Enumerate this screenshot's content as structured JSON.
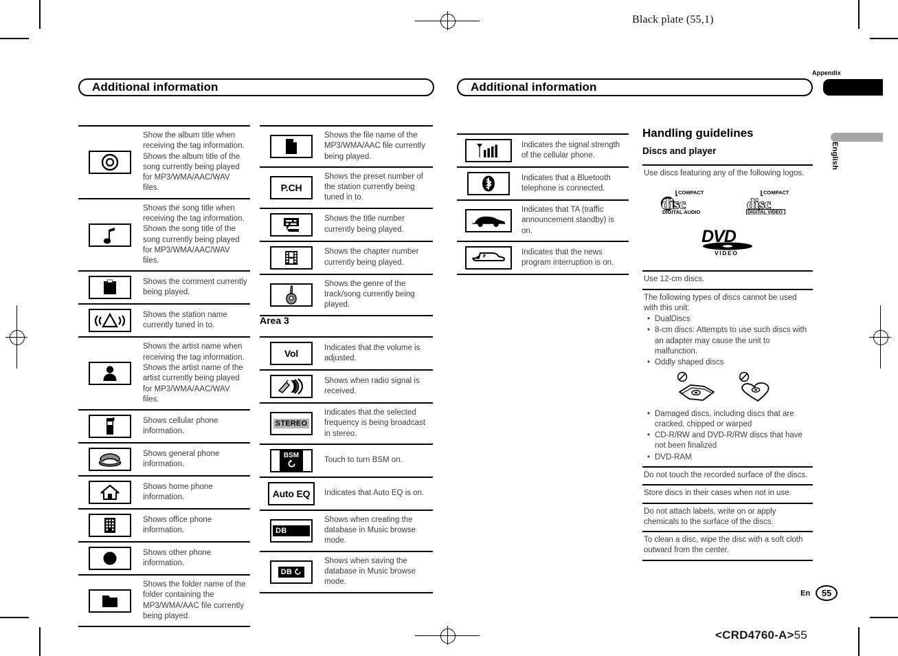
{
  "page": {
    "plate_label": "Black plate (55,1)",
    "footer_code_prefix": "<CRD4760-A>",
    "footer_code_suffix": "55",
    "page_number": "55",
    "page_lang": "En",
    "tab_appendix": "Appendix",
    "tab_english": "English"
  },
  "left_page": {
    "section_title": "Additional information"
  },
  "right_page": {
    "section_title": "Additional information"
  },
  "column1": {
    "rows": [
      {
        "icon": "disc-album-icon",
        "icon_kind": "album",
        "text": "Show the album title when receiving the tag information. Shows the album title of the song currently being played for MP3/WMA/AAC/WAV files."
      },
      {
        "icon": "music-note-icon",
        "icon_kind": "note",
        "text": "Shows the song title when receiving the tag information. Shows the song title of the song currently being played for MP3/WMA/AAC/WAV files."
      },
      {
        "icon": "comment-clipboard-icon",
        "icon_kind": "comment",
        "text": "Shows the comment currently being played."
      },
      {
        "icon": "broadcast-station-icon",
        "icon_kind": "station",
        "text": "Shows the station name currently tuned in to."
      },
      {
        "icon": "artist-person-icon",
        "icon_kind": "artist",
        "text": "Shows the artist name when receiving the tag information. Shows the artist name of the artist currently being played for MP3/WMA/AAC/WAV files."
      },
      {
        "icon": "cellular-phone-icon",
        "icon_kind": "cellphone",
        "text": "Shows cellular phone information."
      },
      {
        "icon": "general-phone-icon",
        "icon_kind": "handset",
        "text": "Shows general phone information."
      },
      {
        "icon": "home-phone-icon",
        "icon_kind": "home",
        "text": "Shows home phone information."
      },
      {
        "icon": "office-phone-icon",
        "icon_kind": "office",
        "text": "Shows office phone information."
      },
      {
        "icon": "other-phone-icon",
        "icon_kind": "circle",
        "text": "Shows other phone information."
      },
      {
        "icon": "folder-icon",
        "icon_kind": "folder",
        "text": "Shows the folder name of the folder containing the MP3/WMA/AAC file currently being played."
      }
    ]
  },
  "column2": {
    "rows": [
      {
        "icon": "file-icon",
        "icon_kind": "file",
        "text": "Shows the file name of the MP3/WMA/AAC file currently being played."
      },
      {
        "icon": "preset-channel-icon",
        "icon_kind": "text",
        "icon_text": "P.CH",
        "text": "Shows the preset number of the station currently being tuned in to."
      },
      {
        "icon": "title-number-icon",
        "icon_kind": "title",
        "text": "Shows the title number currently being played."
      },
      {
        "icon": "film-chapter-icon",
        "icon_kind": "film",
        "text": "Shows the chapter number currently being played."
      },
      {
        "icon": "guitar-genre-icon",
        "icon_kind": "guitar",
        "text": "Shows the genre of the track/song currently being played."
      }
    ],
    "area_heading": "Area 3",
    "area3_rows": [
      {
        "icon": "volume-icon",
        "icon_kind": "text",
        "icon_text": "Vol",
        "text": "Indicates that the volume is adjusted."
      },
      {
        "icon": "radio-signal-icon",
        "icon_kind": "signal",
        "text": "Shows when radio signal is received."
      },
      {
        "icon": "stereo-icon",
        "icon_kind": "badge-gray",
        "icon_text": "STEREO",
        "text": "Indicates that the selected frequency is being broadcast in stereo."
      },
      {
        "icon": "bsm-icon",
        "icon_kind": "bsm",
        "icon_text": "BSM",
        "text": "Touch to turn BSM on."
      },
      {
        "icon": "auto-eq-icon",
        "icon_kind": "text",
        "icon_text": "Auto EQ",
        "text": "Indicates that Auto EQ is on."
      },
      {
        "icon": "database-creating-icon",
        "icon_kind": "badge-black",
        "icon_text": "DB",
        "text": "Shows when creating the database in Music browse mode."
      },
      {
        "icon": "database-saving-icon",
        "icon_kind": "badge-black-refresh",
        "icon_text": "DB",
        "text": "Shows when saving the database in Music browse mode."
      }
    ]
  },
  "column3": {
    "rows": [
      {
        "icon": "signal-strength-icon",
        "icon_kind": "antenna",
        "text": "Indicates the signal strength of the cellular phone."
      },
      {
        "icon": "bluetooth-icon",
        "icon_kind": "bluetooth",
        "text": "Indicates that a Bluetooth telephone is connected."
      },
      {
        "icon": "traffic-announcement-car-icon",
        "icon_kind": "car",
        "text": "Indicates that TA (traffic announcement standby) is on."
      },
      {
        "icon": "news-program-icon",
        "icon_kind": "news",
        "text": "Indicates that the news program interruption is on."
      }
    ]
  },
  "column4": {
    "title": "Handling guidelines",
    "subtitle": "Discs and player",
    "logo_intro": "Use discs featuring any of the following logos.",
    "logos": [
      {
        "name": "compact-disc-digital-audio-logo",
        "top": "COMPACT",
        "mid": "disc",
        "bottom": "DIGITAL AUDIO"
      },
      {
        "name": "compact-disc-digital-video-logo",
        "top": "COMPACT",
        "mid": "disc",
        "bottom": "(DIGITAL VIDEO)"
      },
      {
        "name": "dvd-video-logo",
        "mid": "DVD",
        "bottom": "V I D E O"
      }
    ],
    "notes": [
      {
        "type": "plain",
        "text": "Use 12-cm discs."
      },
      {
        "type": "list",
        "text": "The following types of discs cannot be used with this unit:",
        "items": [
          "DualDiscs",
          "8-cm discs: Attempts to use such discs with an adapter may cause the unit to malfunction.",
          "Oddly shaped discs"
        ],
        "items_after": [
          "Damaged discs, including discs that are cracked, chipped or warped",
          "CD-R/RW and DVD-R/RW discs that have not been finalized",
          "DVD-RAM"
        ]
      },
      {
        "type": "plain",
        "text": "Do not touch the recorded surface of the discs."
      },
      {
        "type": "plain",
        "text": "Store discs in their cases when not in use."
      },
      {
        "type": "plain",
        "text": "Do not attach labels, write on or apply chemicals to the surface of the discs."
      },
      {
        "type": "plain",
        "text": "To clean a disc, wipe the disc with a soft cloth outward from the center."
      }
    ]
  }
}
